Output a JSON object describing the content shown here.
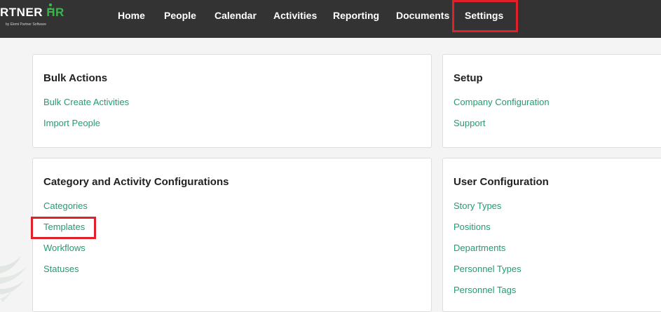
{
  "logo": {
    "text_main": "RTNER ",
    "text_hr": "HR",
    "tagline": "by Elemi Partner Software"
  },
  "nav": {
    "items": [
      "Home",
      "People",
      "Calendar",
      "Activities",
      "Reporting",
      "Documents",
      "Settings"
    ]
  },
  "panels": {
    "bulk_actions": {
      "title": "Bulk Actions",
      "links": [
        "Bulk Create Activities",
        "Import People"
      ]
    },
    "setup": {
      "title": "Setup",
      "links": [
        "Company Configuration",
        "Support"
      ]
    },
    "category_activity": {
      "title": "Category and Activity Configurations",
      "links": [
        "Categories",
        "Templates",
        "Workflows",
        "Statuses"
      ]
    },
    "user_configuration": {
      "title": "User Configuration",
      "links": [
        "Story Types",
        "Positions",
        "Departments",
        "Personnel Types",
        "Personnel Tags"
      ]
    }
  },
  "colors": {
    "topbar": "#333333",
    "link": "#1f9e6e",
    "highlight": "#e0202a",
    "logo_accent": "#39b54a"
  }
}
